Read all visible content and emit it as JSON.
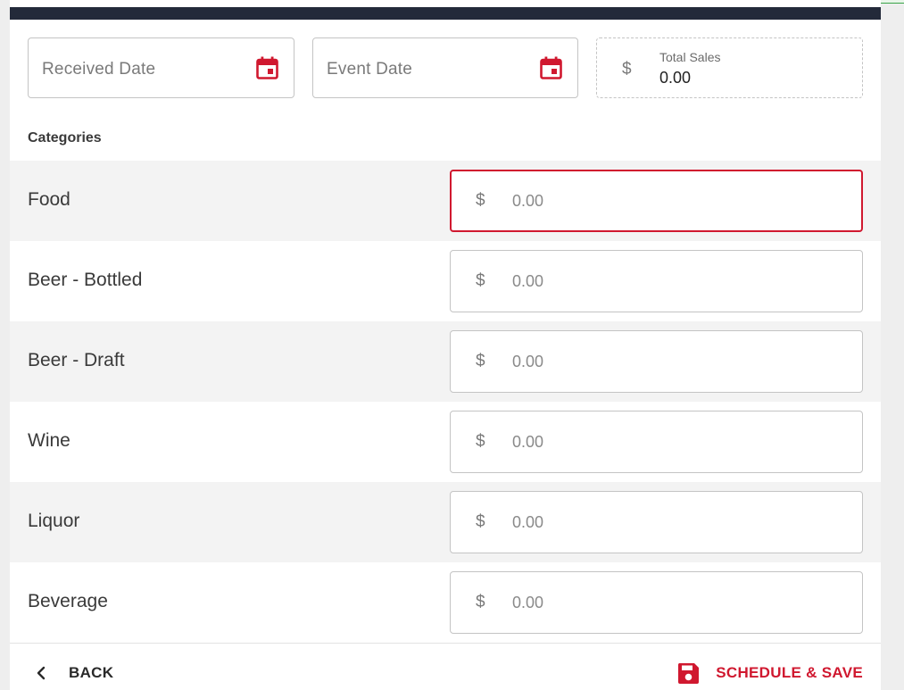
{
  "form": {
    "received_date_placeholder": "Received Date",
    "event_date_placeholder": "Event Date",
    "total_sales": {
      "currency": "$",
      "label": "Total Sales",
      "value": "0.00"
    },
    "categories_heading": "Categories",
    "categories": [
      {
        "name": "Food",
        "currency": "$",
        "value": "0.00"
      },
      {
        "name": "Beer - Bottled",
        "currency": "$",
        "value": "0.00"
      },
      {
        "name": "Beer - Draft",
        "currency": "$",
        "value": "0.00"
      },
      {
        "name": "Wine",
        "currency": "$",
        "value": "0.00"
      },
      {
        "name": "Liquor",
        "currency": "$",
        "value": "0.00"
      },
      {
        "name": "Beverage",
        "currency": "$",
        "value": "0.00"
      }
    ]
  },
  "footer": {
    "back_label": "BACK",
    "save_label": "SCHEDULE & SAVE"
  },
  "icons": {
    "calendar": "calendar-icon",
    "back": "chevron-left-icon",
    "save": "floppy-disk-icon"
  },
  "colors": {
    "accent": "#d0182f",
    "header_bar": "#232a3a",
    "row_shade": "#f3f3f3"
  }
}
